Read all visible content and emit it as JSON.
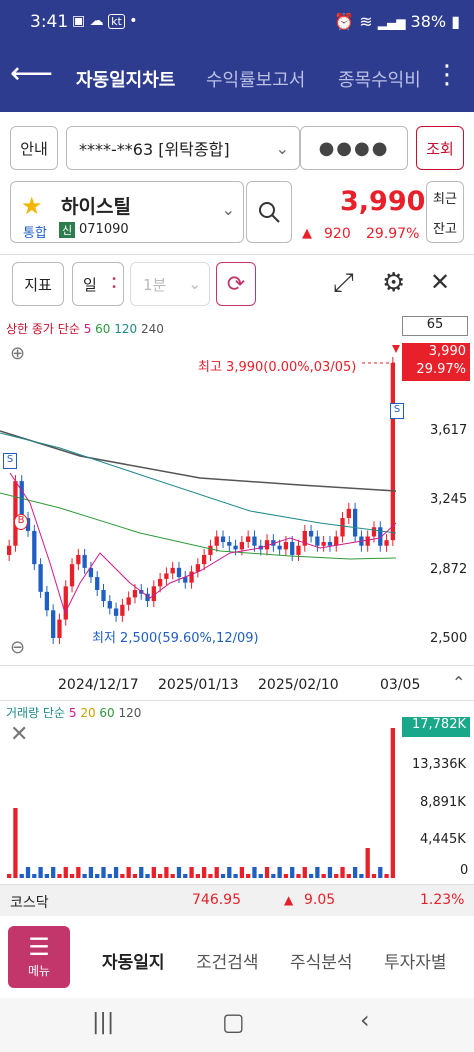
{
  "status": {
    "time": "3:41",
    "carrier": "kt",
    "battery": "38%"
  },
  "nav": {
    "tabs": [
      "자동일지차트",
      "수익률보고서",
      "종목수익비"
    ]
  },
  "account": {
    "guide_label": "안내",
    "account_number": "****-**63 [위탁종합]",
    "password": "●●●●",
    "lookup_label": "조회"
  },
  "stock": {
    "name": "하이스틸",
    "market_label": "통합",
    "credit_label": "신",
    "code": "071090",
    "price": "3,990",
    "change": "920",
    "change_pct": "29.97%",
    "recent_label": "최근",
    "balance_label": "잔고"
  },
  "toolbar": {
    "indicator_label": "지표",
    "period_label": "일",
    "interval_label": "1분"
  },
  "chart": {
    "legend_prefix": "상한 종가 단순",
    "ma": [
      {
        "label": "5",
        "color": "#d11a8c"
      },
      {
        "label": "60",
        "color": "#2e9a3a"
      },
      {
        "label": "120",
        "color": "#1f8a8a"
      },
      {
        "label": "240",
        "color": "#555555"
      }
    ],
    "count_box": "65",
    "current_price": "3,990",
    "current_pct": "29.97%",
    "high_note": "최고 3,990(0.00%,03/05)",
    "low_note": "최저 2,500(59.60%,12/09)",
    "y_ticks": [
      "3,617",
      "3,245",
      "2,872",
      "2,500"
    ],
    "x_ticks": [
      "2024/12/17",
      "2025/01/13",
      "2025/02/10",
      "03/05"
    ],
    "signal_s": "S",
    "signal_b": "B"
  },
  "volume": {
    "legend_prefix": "거래량 단순",
    "ma": [
      {
        "label": "5",
        "color": "#d11a8c"
      },
      {
        "label": "20",
        "color": "#c9a400"
      },
      {
        "label": "60",
        "color": "#2e9a3a"
      },
      {
        "label": "120",
        "color": "#555555"
      }
    ],
    "current": "17,782K",
    "y_ticks": [
      "13,336K",
      "8,891K",
      "4,445K",
      "0"
    ]
  },
  "index": {
    "name": "코스닥",
    "value": "746.95",
    "change": "9.05",
    "pct": "1.23%"
  },
  "bottom": {
    "menu_label": "메뉴",
    "tabs": [
      "자동일지",
      "조건검색",
      "주식분석",
      "투자자별"
    ]
  },
  "colors": {
    "navy": "#2e3c8f",
    "up": "#e8202a",
    "down": "#1f5fc4",
    "menu": "#c2366b"
  },
  "chart_data": {
    "type": "candlestick",
    "x_range": [
      "2024/12/02",
      "2025/03/05"
    ],
    "y_range": [
      2500,
      3990
    ],
    "candles_close": [
      3000,
      3350,
      3150,
      3080,
      2900,
      2750,
      2650,
      2500,
      2600,
      2780,
      2900,
      2950,
      2880,
      2830,
      2760,
      2700,
      2660,
      2620,
      2680,
      2720,
      2760,
      2740,
      2700,
      2780,
      2820,
      2850,
      2880,
      2830,
      2800,
      2860,
      2900,
      2950,
      3000,
      3050,
      3020,
      3000,
      2980,
      3020,
      3050,
      3000,
      2980,
      3030,
      3000,
      2980,
      3020,
      2950,
      3000,
      3080,
      3050,
      3000,
      3020,
      3000,
      3050,
      3150,
      3200,
      3050,
      3000,
      3050,
      3100,
      3000,
      3030,
      3990
    ]
  }
}
